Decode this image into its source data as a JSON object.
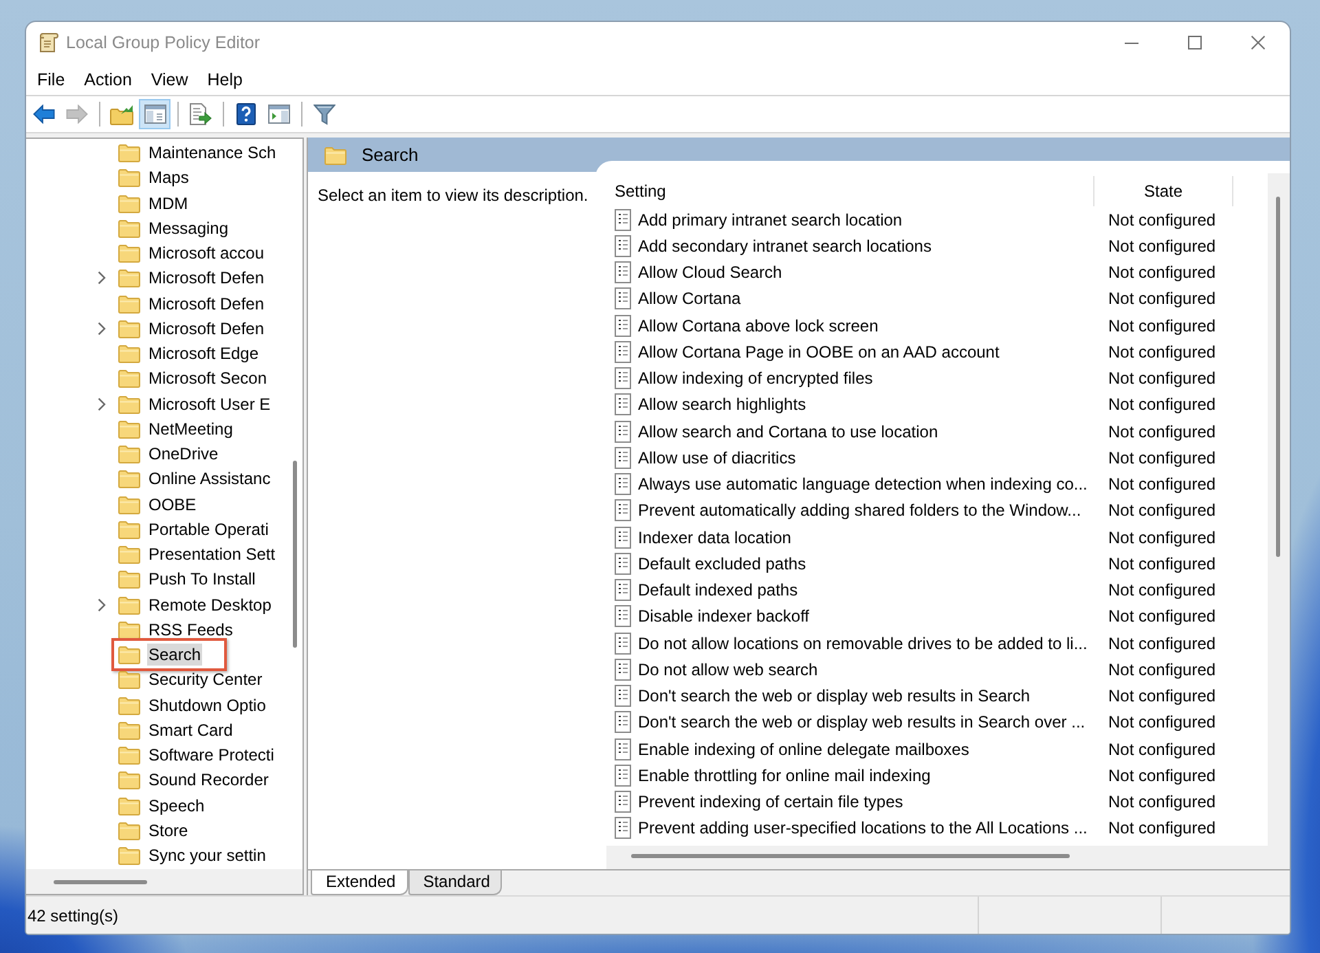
{
  "window": {
    "title": "Local Group Policy Editor"
  },
  "menu": [
    {
      "label": "File"
    },
    {
      "label": "Action"
    },
    {
      "label": "View"
    },
    {
      "label": "Help"
    }
  ],
  "toolbar": [
    [
      {
        "kind": "back",
        "disabled": false,
        "pressed": false
      },
      {
        "kind": "forward",
        "disabled": true,
        "pressed": false
      }
    ],
    [
      {
        "kind": "up",
        "disabled": false,
        "pressed": false
      },
      {
        "kind": "console-tree",
        "disabled": false,
        "pressed": true
      }
    ],
    [
      {
        "kind": "export",
        "disabled": false,
        "pressed": false
      }
    ],
    [
      {
        "kind": "help",
        "disabled": false,
        "pressed": false
      },
      {
        "kind": "action-pane",
        "disabled": false,
        "pressed": false
      }
    ],
    [
      {
        "kind": "filter",
        "disabled": false,
        "pressed": false
      }
    ]
  ],
  "tree": {
    "items": [
      {
        "label": "Maintenance Sch",
        "expandable": false,
        "selected": false,
        "highlighted": false
      },
      {
        "label": "Maps",
        "expandable": false,
        "selected": false,
        "highlighted": false
      },
      {
        "label": "MDM",
        "expandable": false,
        "selected": false,
        "highlighted": false
      },
      {
        "label": "Messaging",
        "expandable": false,
        "selected": false,
        "highlighted": false
      },
      {
        "label": "Microsoft accou",
        "expandable": false,
        "selected": false,
        "highlighted": false
      },
      {
        "label": "Microsoft Defen",
        "expandable": true,
        "selected": false,
        "highlighted": false
      },
      {
        "label": "Microsoft Defen",
        "expandable": false,
        "selected": false,
        "highlighted": false
      },
      {
        "label": "Microsoft Defen",
        "expandable": true,
        "selected": false,
        "highlighted": false
      },
      {
        "label": "Microsoft Edge",
        "expandable": false,
        "selected": false,
        "highlighted": false
      },
      {
        "label": "Microsoft Secon",
        "expandable": false,
        "selected": false,
        "highlighted": false
      },
      {
        "label": "Microsoft User E",
        "expandable": true,
        "selected": false,
        "highlighted": false
      },
      {
        "label": "NetMeeting",
        "expandable": false,
        "selected": false,
        "highlighted": false
      },
      {
        "label": "OneDrive",
        "expandable": false,
        "selected": false,
        "highlighted": false
      },
      {
        "label": "Online Assistanc",
        "expandable": false,
        "selected": false,
        "highlighted": false
      },
      {
        "label": "OOBE",
        "expandable": false,
        "selected": false,
        "highlighted": false
      },
      {
        "label": "Portable Operati",
        "expandable": false,
        "selected": false,
        "highlighted": false
      },
      {
        "label": "Presentation Sett",
        "expandable": false,
        "selected": false,
        "highlighted": false
      },
      {
        "label": "Push To Install",
        "expandable": false,
        "selected": false,
        "highlighted": false
      },
      {
        "label": "Remote Desktop",
        "expandable": true,
        "selected": false,
        "highlighted": false
      },
      {
        "label": "RSS Feeds",
        "expandable": false,
        "selected": false,
        "highlighted": false
      },
      {
        "label": "Search",
        "expandable": false,
        "selected": true,
        "highlighted": true
      },
      {
        "label": "Security Center",
        "expandable": false,
        "selected": false,
        "highlighted": false
      },
      {
        "label": "Shutdown Optio",
        "expandable": false,
        "selected": false,
        "highlighted": false
      },
      {
        "label": "Smart Card",
        "expandable": false,
        "selected": false,
        "highlighted": false
      },
      {
        "label": "Software Protecti",
        "expandable": false,
        "selected": false,
        "highlighted": false
      },
      {
        "label": "Sound Recorder",
        "expandable": false,
        "selected": false,
        "highlighted": false
      },
      {
        "label": "Speech",
        "expandable": false,
        "selected": false,
        "highlighted": false
      },
      {
        "label": "Store",
        "expandable": false,
        "selected": false,
        "highlighted": false
      },
      {
        "label": "Sync your settin",
        "expandable": false,
        "selected": false,
        "highlighted": false
      }
    ]
  },
  "details": {
    "title": "Search",
    "description": "Select an item to view its description.",
    "columns": [
      "Setting",
      "State"
    ],
    "rows": [
      {
        "setting": "Add primary intranet search location",
        "state": "Not configured"
      },
      {
        "setting": "Add secondary intranet search locations",
        "state": "Not configured"
      },
      {
        "setting": "Allow Cloud Search",
        "state": "Not configured"
      },
      {
        "setting": "Allow Cortana",
        "state": "Not configured"
      },
      {
        "setting": "Allow Cortana above lock screen",
        "state": "Not configured"
      },
      {
        "setting": "Allow Cortana Page in OOBE on an AAD account",
        "state": "Not configured"
      },
      {
        "setting": "Allow indexing of encrypted files",
        "state": "Not configured"
      },
      {
        "setting": "Allow search highlights",
        "state": "Not configured"
      },
      {
        "setting": "Allow search and Cortana to use location",
        "state": "Not configured"
      },
      {
        "setting": "Allow use of diacritics",
        "state": "Not configured"
      },
      {
        "setting": "Always use automatic language detection when indexing co...",
        "state": "Not configured"
      },
      {
        "setting": "Prevent automatically adding shared folders to the Window...",
        "state": "Not configured"
      },
      {
        "setting": "Indexer data location",
        "state": "Not configured"
      },
      {
        "setting": "Default excluded paths",
        "state": "Not configured"
      },
      {
        "setting": "Default indexed paths",
        "state": "Not configured"
      },
      {
        "setting": "Disable indexer backoff",
        "state": "Not configured"
      },
      {
        "setting": "Do not allow locations on removable drives to be added to li...",
        "state": "Not configured"
      },
      {
        "setting": "Do not allow web search",
        "state": "Not configured"
      },
      {
        "setting": "Don't search the web or display web results in Search",
        "state": "Not configured"
      },
      {
        "setting": "Don't search the web or display web results in Search over ...",
        "state": "Not configured"
      },
      {
        "setting": "Enable indexing of online delegate mailboxes",
        "state": "Not configured"
      },
      {
        "setting": "Enable throttling for online mail indexing",
        "state": "Not configured"
      },
      {
        "setting": "Prevent indexing of certain file types",
        "state": "Not configured"
      },
      {
        "setting": "Prevent adding user-specified locations to the All Locations ...",
        "state": "Not configured"
      }
    ]
  },
  "view_tabs": [
    {
      "label": "Extended",
      "selected": true
    },
    {
      "label": "Standard",
      "selected": false
    }
  ],
  "status_bar": {
    "text": "42 setting(s)"
  }
}
